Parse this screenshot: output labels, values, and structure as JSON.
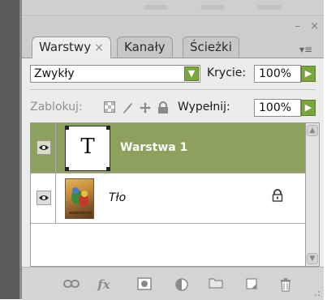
{
  "tabs": [
    {
      "label": "Warstwy",
      "close": "×"
    },
    {
      "label": "Kanały"
    },
    {
      "label": "Ścieżki"
    }
  ],
  "window_controls": {
    "minimize": "–",
    "close": "×"
  },
  "panel_menu_glyph": "▾≡",
  "blend_mode": {
    "value": "Zwykły"
  },
  "opacity": {
    "label": "Krycie:",
    "value": "100%"
  },
  "lock": {
    "label": "Zablokuj:"
  },
  "fill": {
    "label": "Wypełnij:",
    "value": "100%"
  },
  "layers": [
    {
      "name": "Warstwa 1",
      "thumb": "T",
      "selected": true,
      "visible": true
    },
    {
      "name": "Tło",
      "selected": false,
      "visible": true,
      "locked": true
    }
  ],
  "bottom_icons": [
    "link-layers-icon",
    "fx-icon",
    "add-mask-icon",
    "adjustment-layer-icon",
    "new-group-icon",
    "new-layer-icon",
    "delete-layer-icon"
  ],
  "bottom_glyphs": {
    "fx": "fx"
  },
  "colors": {
    "accent_green": "#7ba63d",
    "selected_row": "#8ea05e"
  }
}
